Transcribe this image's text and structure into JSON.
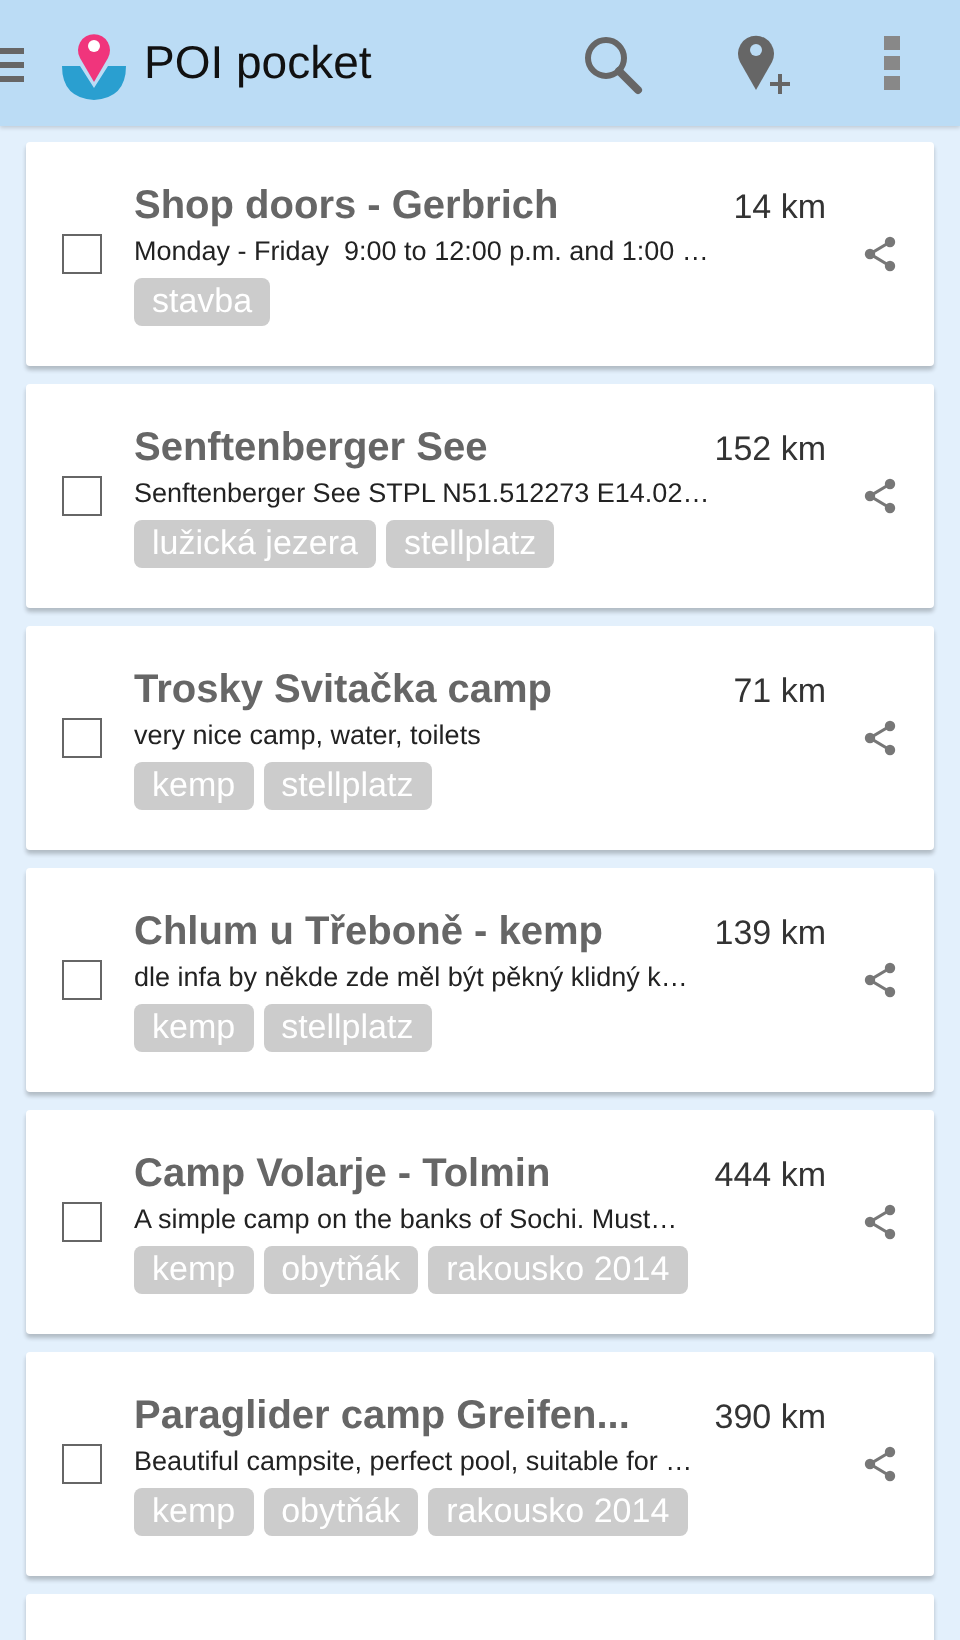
{
  "app_bar": {
    "title": "POI pocket"
  },
  "places": [
    {
      "name": "Shop doors - Gerbrich",
      "distance": "14 km",
      "description": "Monday - Friday  9:00 to 12:00 p.m. and 1:00 …",
      "checked": false,
      "tags": [
        "stavba"
      ]
    },
    {
      "name": "Senftenberger See",
      "distance": "152 km",
      "description": "Senftenberger See STPL N51.512273 E14.02…",
      "checked": false,
      "tags": [
        "lužická jezera",
        "stellplatz"
      ]
    },
    {
      "name": "Trosky Svitačka camp",
      "distance": "71 km",
      "description": "very nice camp, water, toilets",
      "checked": false,
      "tags": [
        "kemp",
        "stellplatz"
      ]
    },
    {
      "name": "Chlum u Třeboně - kemp",
      "distance": "139 km",
      "description": "dle infa by někde zde měl být pěkný klidný k…",
      "checked": false,
      "tags": [
        "kemp",
        "stellplatz"
      ]
    },
    {
      "name": "Camp Volarje - Tolmin",
      "distance": "444 km",
      "description": "A simple camp on the banks of Sochi. Must…",
      "checked": false,
      "tags": [
        "kemp",
        "obytňák",
        "rakousko 2014"
      ]
    },
    {
      "name": "Paraglider camp Greifen...",
      "distance": "390 km",
      "description": "Beautiful campsite, perfect pool, suitable for …",
      "checked": false,
      "tags": [
        "kemp",
        "obytňák",
        "rakousko 2014"
      ]
    }
  ]
}
